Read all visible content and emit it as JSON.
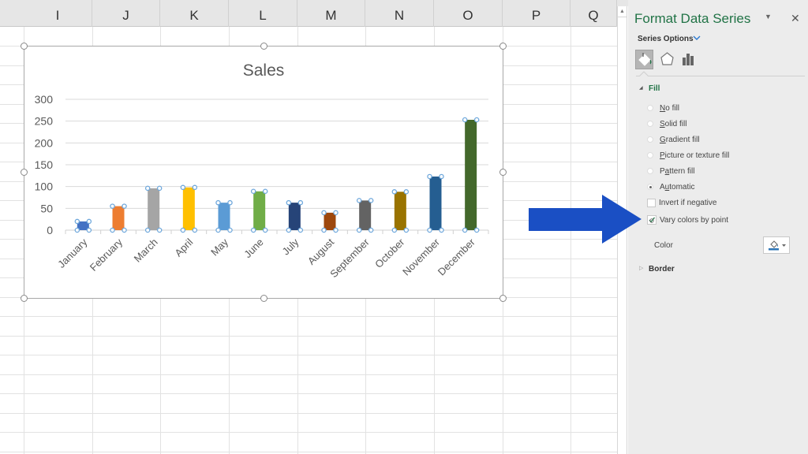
{
  "spreadsheet": {
    "columns": [
      "I",
      "J",
      "K",
      "L",
      "M",
      "N",
      "O",
      "P",
      "Q"
    ]
  },
  "chart_data": {
    "type": "bar",
    "title": "Sales",
    "categories": [
      "January",
      "February",
      "March",
      "April",
      "May",
      "June",
      "July",
      "August",
      "September",
      "October",
      "November",
      "December"
    ],
    "values": [
      20,
      55,
      96,
      98,
      63,
      89,
      63,
      40,
      68,
      88,
      123,
      253
    ],
    "bar_colors": [
      "#4472c4",
      "#ed7d31",
      "#a5a5a5",
      "#ffc000",
      "#5b9bd5",
      "#70ad47",
      "#264478",
      "#9e480e",
      "#636363",
      "#997300",
      "#255e91",
      "#43682b"
    ],
    "xlabel": "",
    "ylabel": "",
    "ylim": [
      0,
      300
    ],
    "yticks": [
      0,
      50,
      100,
      150,
      200,
      250,
      300
    ],
    "grid": true,
    "legend": "none",
    "selected": true
  },
  "pane": {
    "title": "Format Data Series",
    "series_options_label": "Series Options",
    "tabs": [
      {
        "name": "fill-line",
        "icon": "paint-bucket-icon",
        "active": true
      },
      {
        "name": "effects",
        "icon": "pentagon-icon",
        "active": false
      },
      {
        "name": "series-options",
        "icon": "bar-chart-icon",
        "active": false
      }
    ],
    "fill_section": "Fill",
    "fill_options": [
      {
        "label": "No fill",
        "accel": "N",
        "checked": false
      },
      {
        "label": "Solid fill",
        "accel": "S",
        "checked": false
      },
      {
        "label": "Gradient fill",
        "accel": "G",
        "checked": false
      },
      {
        "label": "Picture or texture fill",
        "accel": "P",
        "checked": false
      },
      {
        "label": "Pattern fill",
        "accel": "A",
        "checked": false
      },
      {
        "label": "Automatic",
        "accel": "U",
        "checked": true
      }
    ],
    "invert_if_negative": {
      "label": "Invert if negative",
      "checked": false
    },
    "vary_colors_by_point": {
      "label": "Vary colors by point",
      "checked": true
    },
    "color_label": "Color",
    "color_value": "#2e75b6",
    "border_section": "Border"
  },
  "annotation": {
    "arrow_color": "#1a4fc4",
    "points_to": "Vary colors by point"
  }
}
